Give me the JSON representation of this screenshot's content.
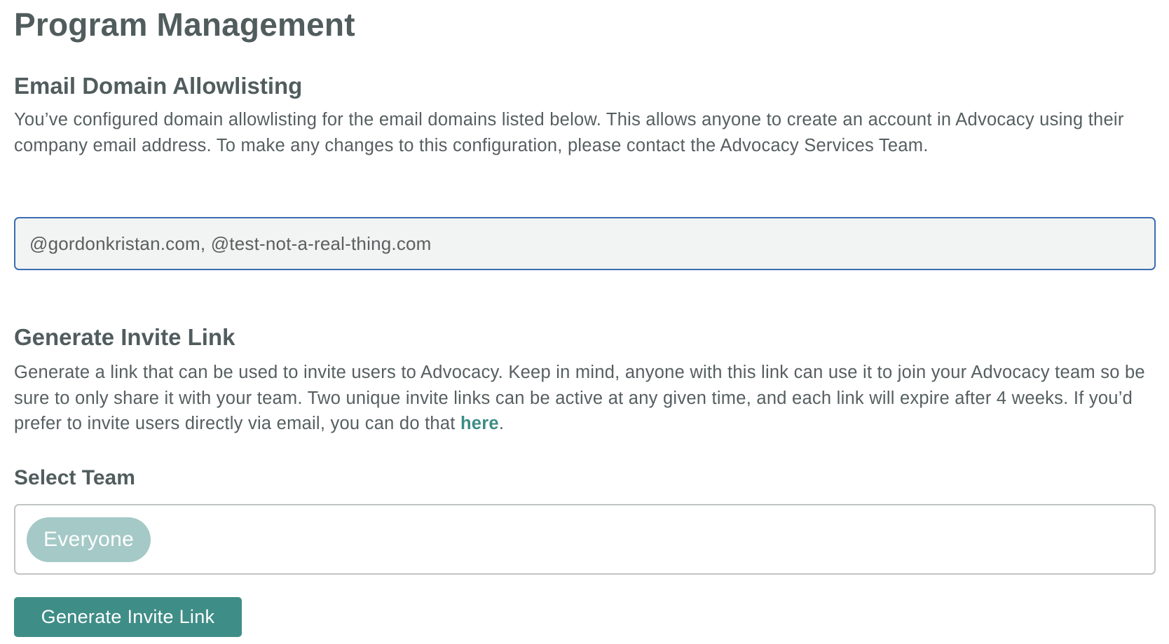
{
  "page": {
    "title": "Program Management"
  },
  "allowlisting": {
    "heading": "Email Domain Allowlisting",
    "description": "You’ve configured domain allowlisting for the email domains listed below. This allows anyone to create an account in Advocacy using their company email address. To make any changes to this configuration, please contact the Advocacy Services Team.",
    "domains_value": "@gordonkristan.com, @test-not-a-real-thing.com"
  },
  "invite": {
    "heading": "Generate Invite Link",
    "description_before_link": "Generate a link that can be used to invite users to Advocacy. Keep in mind, anyone with this link can use it to join your Advocacy team so be sure to only share it with your team. Two unique invite links can be active at any given time, and each link will expire after 4 weeks. If you’d prefer to invite users directly via email, you can do that ",
    "link_text": "here",
    "description_after_link": ".",
    "select_team_label": "Select Team",
    "selected_teams": [
      "Everyone"
    ],
    "button_label": "Generate Invite Link"
  },
  "colors": {
    "heading_text": "#515c5d",
    "link": "#3c8c86",
    "primary_button": "#3f8d87",
    "chip": "#a4c9c6",
    "focused_border": "#3b6db3",
    "field_background": "#f2f4f3"
  }
}
